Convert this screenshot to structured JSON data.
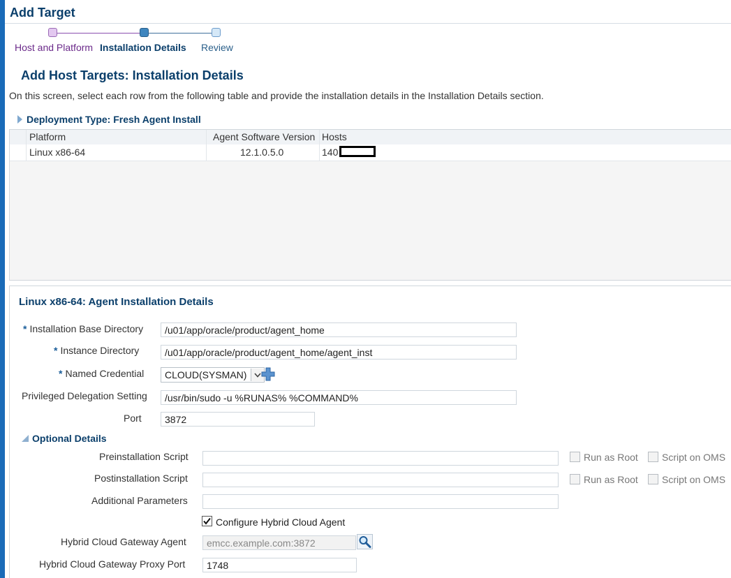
{
  "page_title": "Add Target",
  "train": {
    "steps": [
      {
        "label": "Host and Platform",
        "state": "visited"
      },
      {
        "label": "Installation Details",
        "state": "current"
      },
      {
        "label": "Review",
        "state": "next"
      }
    ]
  },
  "section_title": "Add Host Targets: Installation Details",
  "instructions": "On this screen, select each row from the following table and provide the installation details in the Installation Details section.",
  "deployment": {
    "header": "Deployment Type: Fresh Agent Install",
    "columns": [
      "Platform",
      "Agent Software Version",
      "Hosts"
    ],
    "rows": [
      {
        "platform": "Linux x86-64",
        "version": "12.1.0.5.0",
        "hosts": "140"
      }
    ]
  },
  "details": {
    "title": "Linux x86-64: Agent Installation Details",
    "install_base_label": "Installation Base Directory",
    "install_base_value": "/u01/app/oracle/product/agent_home",
    "instance_dir_label": "Instance Directory",
    "instance_dir_value": "/u01/app/oracle/product/agent_home/agent_inst",
    "named_credential_label": "Named Credential",
    "named_credential_value": "CLOUD(SYSMAN)",
    "priv_label": "Privileged Delegation Setting",
    "priv_value": "/usr/bin/sudo -u %RUNAS% %COMMAND%",
    "port_label": "Port",
    "port_value": "3872",
    "required_marker": "*"
  },
  "optional": {
    "header": "Optional Details",
    "preinstall_label": "Preinstallation Script",
    "preinstall_value": "",
    "postinstall_label": "Postinstallation Script",
    "postinstall_value": "",
    "additional_label": "Additional Parameters",
    "additional_value": "",
    "run_as_root_label": "Run as Root",
    "script_on_oms_label": "Script on OMS",
    "hybrid_checkbox_label": "Configure Hybrid Cloud Agent",
    "hybrid_checked": true,
    "gateway_agent_label": "Hybrid Cloud Gateway Agent",
    "gateway_agent_value": "emcc.example.com:3872",
    "gateway_proxy_label": "Hybrid Cloud Gateway Proxy Port",
    "gateway_proxy_value": "1748"
  },
  "colors": {
    "accent": "#1a6bb8",
    "heading": "#0b3f6b",
    "train_visited": "#6b2a8a"
  }
}
